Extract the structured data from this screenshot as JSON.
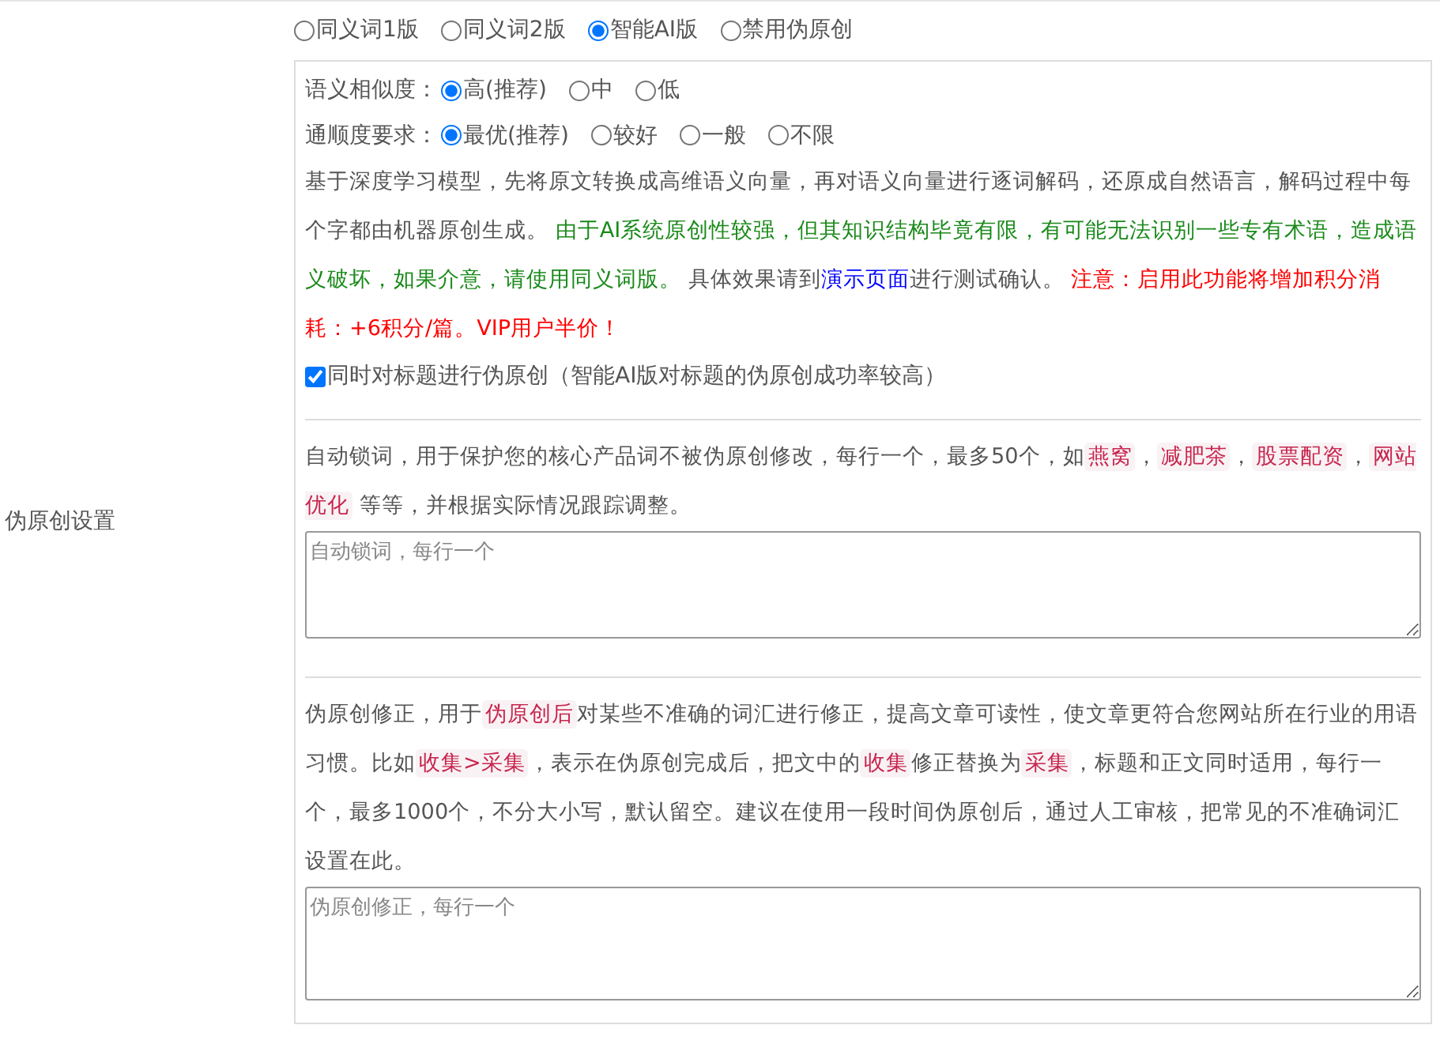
{
  "sidebar_label": "伪原创设置",
  "mode_options": [
    {
      "label": "同义词1版",
      "selected": false
    },
    {
      "label": "同义词2版",
      "selected": false
    },
    {
      "label": "智能AI版",
      "selected": true
    },
    {
      "label": "禁用伪原创",
      "selected": false
    }
  ],
  "ai_settings": {
    "rows": [
      {
        "label": "语义相似度：",
        "options": [
          {
            "label": "高(推荐)",
            "selected": true
          },
          {
            "label": "中",
            "selected": false
          },
          {
            "label": "低",
            "selected": false
          }
        ]
      },
      {
        "label": "通顺度要求：",
        "options": [
          {
            "label": "最优(推荐)",
            "selected": true
          },
          {
            "label": "较好",
            "selected": false
          },
          {
            "label": "一般",
            "selected": false
          },
          {
            "label": "不限",
            "selected": false
          }
        ]
      }
    ],
    "description": [
      {
        "kind": "plain",
        "text": "基于深度学习模型，先将原文转换成高维语义向量，再对语义向量进行逐词解码，还原成自然语言，解码过程中每个字都由机器原创生成。 "
      },
      {
        "kind": "notice",
        "text": "由于AI系统原创性较强，但其知识结构毕竟有限，有可能无法识别一些专有术语，造成语义破坏，如果介意，请使用同义词版。"
      },
      {
        "kind": "plain",
        "text": " 具体效果请到"
      },
      {
        "kind": "link",
        "text": "演示页面"
      },
      {
        "kind": "plain",
        "text": "进行测试确认。 "
      },
      {
        "kind": "warning",
        "text": "注意：启用此功能将增加积分消耗：+6积分/篇。VIP用户半价！"
      }
    ],
    "title_option": {
      "label": "同时对标题进行伪原创（智能AI版对标题的伪原创成功率较高）",
      "checked": true
    }
  },
  "lock_words": {
    "description": [
      {
        "kind": "plain",
        "text": "自动锁词，用于保护您的核心产品词不被伪原创修改，每行一个，最多50个，如"
      },
      {
        "kind": "code",
        "text": "燕窝"
      },
      {
        "kind": "plain",
        "text": "，"
      },
      {
        "kind": "code",
        "text": "减肥茶"
      },
      {
        "kind": "plain",
        "text": "，"
      },
      {
        "kind": "code",
        "text": "股票配资"
      },
      {
        "kind": "plain",
        "text": "，"
      },
      {
        "kind": "code",
        "text": "网站优化"
      },
      {
        "kind": "plain",
        "text": " 等等，并根据实际情况跟踪调整。"
      }
    ],
    "placeholder": "自动锁词，每行一个"
  },
  "corrections": {
    "description": [
      {
        "kind": "plain",
        "text": "伪原创修正，用于"
      },
      {
        "kind": "code",
        "text": "伪原创后"
      },
      {
        "kind": "plain",
        "text": "对某些不准确的词汇进行修正，提高文章可读性，使文章更符合您网站所在行业的用语习惯。比如"
      },
      {
        "kind": "code",
        "text": "收集>采集"
      },
      {
        "kind": "plain",
        "text": "，表示在伪原创完成后，把文中的"
      },
      {
        "kind": "code",
        "text": "收集"
      },
      {
        "kind": "plain",
        "text": "修正替换为"
      },
      {
        "kind": "code",
        "text": "采集"
      },
      {
        "kind": "plain",
        "text": "，标题和正文同时适用，每行一个，最多1000个，不分大小写，默认留空。建议在使用一段时间伪原创后，通过人工审核，把常见的不准确词汇设置在此。"
      }
    ],
    "placeholder": "伪原创修正，每行一个"
  }
}
